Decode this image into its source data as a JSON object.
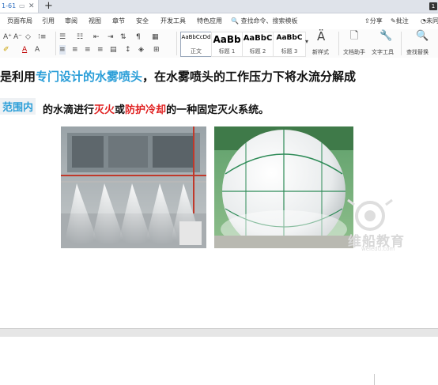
{
  "tabbar": {
    "doc_tab_label": "1-61",
    "new_tab_glyph": "+",
    "badge": "1"
  },
  "menu": {
    "items": [
      "页面布局",
      "引用",
      "审阅",
      "视图",
      "章节",
      "安全",
      "开发工具",
      "特色应用"
    ],
    "search_label": "查找命令、搜索模板",
    "share": "分享",
    "comment": "批注",
    "more": "未同"
  },
  "ribbon": {
    "font_sizes": [
      "A⁺",
      "A⁻"
    ],
    "styles": [
      {
        "sample": "AaBbCcDd",
        "caption": "正文"
      },
      {
        "sample": "AaBb",
        "caption": "标题 1"
      },
      {
        "sample": "AaBbC",
        "caption": "标题 2"
      },
      {
        "sample": "AaBbC",
        "caption": "标题 3"
      }
    ],
    "new_style": "新样式",
    "doc_helper": "文档助手",
    "text_tools": "文字工具",
    "find_replace": "查找替换"
  },
  "doc": {
    "line1": {
      "part1": "是利用",
      "part2": "专门设计的水雾喷头",
      "part3": "，在水雾喷头的工作压力下将水流分解成"
    },
    "line2": {
      "scope_tag": "范围内",
      "part1": "的水滴进行",
      "part2": "灭火",
      "part3": "或",
      "part4": "防护冷却",
      "part5": "的一种固定灭火系统。"
    },
    "watermark": {
      "text": "维船教育",
      "url": "weiedu.com"
    }
  },
  "icons": [
    "search-icon",
    "share-icon",
    "comment-icon",
    "close-icon",
    "plus-icon",
    "doc-helper-icon",
    "wrench-icon"
  ],
  "colors": {
    "accent_blue": "#2a9ed8",
    "accent_red": "#e02020",
    "ribbon_bg": "#fbfbfb"
  }
}
